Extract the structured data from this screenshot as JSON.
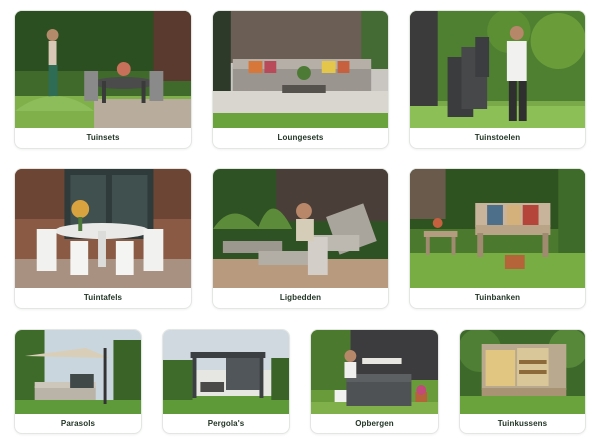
{
  "categories": [
    {
      "label": "Tuinsets"
    },
    {
      "label": "Loungesets"
    },
    {
      "label": "Tuinstoelen"
    },
    {
      "label": "Tuintafels"
    },
    {
      "label": "Ligbedden"
    },
    {
      "label": "Tuinbanken"
    },
    {
      "label": "Parasols"
    },
    {
      "label": "Pergola's"
    },
    {
      "label": "Opbergen"
    },
    {
      "label": "Tuinkussens"
    }
  ],
  "colors": {
    "label_text": "#233527",
    "card_border": "#e3e6e3",
    "grass": "#5f9a3a",
    "foliage": "#2e5a22"
  }
}
